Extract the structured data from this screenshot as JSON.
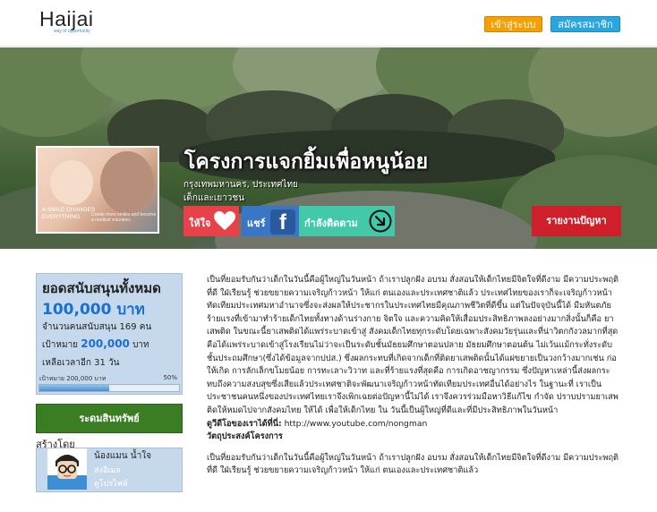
{
  "header": {
    "logo": "Haijai",
    "tagline": "way of opportunity",
    "login_label": "เข้าสู่ระบบ",
    "register_label": "สมัครสมาชิก"
  },
  "hero": {
    "promo": {
      "headline": "A SMILE CHANGES EVERYTHING",
      "subtext": "Create more smiles and become a medical volunteer."
    },
    "title": "โครงการแจกยิ้มเพื่อหนูน้อย",
    "location": "กรุงเทพมหานคร, ประเทศไทย",
    "category": "เด็กและเยาวชน",
    "give_label": "ให้ใจ",
    "share_label": "แชร์",
    "follow_label": "กำลังติดตาม",
    "report_label": "รายงานปัญหา"
  },
  "funding": {
    "title": "ยอดสนับสนุนทั้งหมด",
    "amount": "100,000 บาท",
    "supporters": "จำนวนคนสนับสนุน 169 คน",
    "goal_prefix": "เป้าหมาย",
    "goal_value": "200,000",
    "goal_unit": "บาท",
    "days_left": "เหลือเวลาอีก 31 วัน",
    "bar_label": "เป้าหมาย 200,000 บาท",
    "percent_label": "50%",
    "progress": 0.5
  },
  "sidebar": {
    "shop_label": "ระดมสินทรัพย์",
    "created_by_label": "สร้างโดย",
    "creator_name": "น้องแมน น้ำใจ",
    "creator_email": "ส่งอีเมล",
    "profile_link": "ดูโปรไฟล์"
  },
  "content": {
    "paragraph": "เป็นที่ยอมรับกันว่าเด็กในวันนี้คือผู้ใหญ่ในวันหน้า ถ้าเราปลูกฝัง อบรม สั่งสอนให้เด็กไทยมีจิตใจที่ดีงาม มีความประพฤติที่ดี ใฝ่เรียนรู้ ช่วยขยายความเจริญก้าวหน้า ให้แก่ ตนเองและประเทศชาติแล้ว ประเทศไทยของเราก็จะเจริญก้าวหน้าทัดเทียมประเทศมหาอำนาจซึ่งจะส่งผลให้ประชากรในประเทศไทยมีคุณภาพชีวิตที่ดีขึ้น แต่ในปัจจุบันนี้ได้ มีมหันตภัยร้ายแรงที่เข้ามาทำร้ายเด็กไทยทั้งทางด้านร่างกาย จิตใจ และความคิดให้เสื่อมประสิทธิภาพลงอย่างมากสิ่งนั้นก็คือ ยาเสพติด ในขณะนี้ยาเสพติดได้แพร่ระบาดเข้าสู่ สังคมเด็กไทยทุกระดับโดยเฉพาะสังคมวัยรุ่นและที่น่าวิตกกังวลมากที่สุดคือได้แพร่ระบาดเข้าสู่โรงเรียนไม่ว่าจะเป็นระดับชั้นมัธยมศึกษาตอนปลาย มัธยมศึกษาตอนต้น ไม่เว้นแม้กระทั่งระดับชั้นประถมศึกษา(ซึ่งได้ข้อมูลจากปปส.) ซึ่งผลกระทบที่เกิดจากเด็กที่ติดยาเสพติดนั้นได้แผ่ขยายเป็นวงกว้างมากเช่น ก่อให้เกิด การลักเล็กขโมยน้อย การทะเลาะวิวาท และที่ร้ายแรงที่สุดคือ การเกิดอาชญากรรม ซึ่งปัญหาเหล่านี้ส่งผลกระทบถึงความสงบสุขซึ่งเสียแล้วประเทศชาติจะพัฒนาเจริญก้าวหน้าทัดเทียมประเทศอื่นได้อย่างไร ในฐานะที่ เราเป็นประชาชนคนหนึ่งของประเทศไทยเราจึงเพิกเฉยต่อปัญหานี้ไม่ได้ เราจึงควรร่วมมือหาวิธีแก้ไข กำจัด ปราบปรามยาเสพติดให้หมดไปจากสังคมไทย ให้ได้ เพื่อให้เด็กไทย ใน วันนี้เป็นผู้ใหญ่ที่ดีและที่มีประสิทธิภาพในวันหน้า",
    "video_label": "ดูวีดีโอของเราได้ที่นี่:",
    "video_url": "http://www.youtube.com/nongman",
    "objective_title": "วัตถุประสงค์โครงการ",
    "paragraph2": "เป็นที่ยอมรับกันว่าเด็กในวันนี้คือผู้ใหญ่ในวันหน้า ถ้าเราปลูกฝัง อบรม สั่งสอนให้เด็กไทยมีจิตใจที่ดีงาม มีความประพฤติที่ดี ใฝ่เรียนรู้ ช่วยขยายความเจริญก้าวหน้า ให้แก่ ตนเองและประเทศชาติแล้ว"
  },
  "colors": {
    "login": "#f5a000",
    "register": "#2aa6df",
    "give": "#e8414a",
    "share": "#3a76c6",
    "follow": "#43c9a9",
    "report": "#cf1f2a",
    "shop": "#3b7d23",
    "panel": "#c6d9ec",
    "amount": "#1a6fd4"
  },
  "icons": {
    "give": "heart-icon",
    "share": "facebook-icon",
    "follow": "arrow-down-right-icon"
  }
}
